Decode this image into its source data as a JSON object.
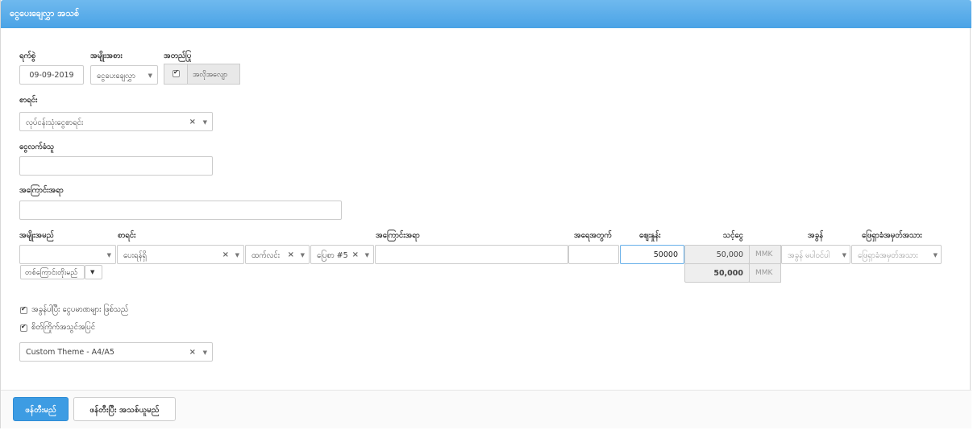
{
  "header": {
    "title": "ငွေပေးချေလွှာ အသစ်"
  },
  "form": {
    "date_label": "ရက်စွဲ",
    "date_value": "09-09-2019",
    "type_label": "အမျိုးအစား",
    "type_value": "ငွေပေးချေလွှာ",
    "approved_label": "အတည်ပြု",
    "approved_checkbox_label": "အလိုအလျော",
    "account_label": "စာရင်း",
    "account_value": "လုပ်ငန်းသုံးငွေစာရင်း",
    "payee_label": "ငွေလက်ခံသူ",
    "payee_value": "",
    "description_label": "အကြောင်းအရာ",
    "description_value": ""
  },
  "items": {
    "headers": {
      "item_type": "အမျိုးအမည်",
      "account": "စာရင်း",
      "description": "အကြောင်းအရာ",
      "quantity": "အရေအတွက်",
      "price": "ဈေးနှုန်း",
      "amount": "သင့်ငွေ",
      "tax": "အခွန်",
      "tax_note": "ဖြေရှာခံအမှတ်အသား"
    },
    "row": {
      "item_type": "",
      "account": "ပေးရန်ရှိ",
      "sub1": "ထက်လင်း",
      "sub2": "ပြေစာ #5",
      "description": "",
      "quantity": "",
      "price": "50000",
      "amount": "50,000",
      "currency": "MMK",
      "tax_placeholder": "အခွန် မပါဝင်ပါ",
      "tax_note_placeholder": "ဖြေရှာခံအမှတ်အသား"
    },
    "add_row_label": "တစ်ကြောင်းတိုးမည်",
    "total": "50,000",
    "total_currency": "MMK"
  },
  "options": {
    "option1": "အခွန်ပါပြီး ငွေပမာဏများ ဖြစ်သည်",
    "option2": "စိတ်ကြိုက်အသွင်အပြင်",
    "theme_value": "Custom Theme - A4/A5"
  },
  "footer": {
    "save_label": "ဖန်တီးမည်",
    "save_new_label": "ဖန်တီးပြီး အသစ်ယူမည်"
  }
}
